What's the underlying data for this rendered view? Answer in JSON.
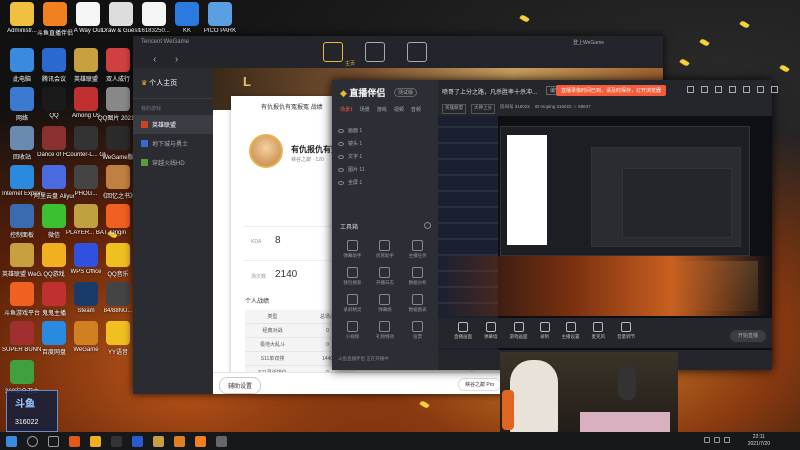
{
  "desktop": {
    "icons": [
      {
        "label": "Administr...",
        "color": "#f0c040"
      },
      {
        "label": "斗鱼直播伴侣",
        "color": "#f08020"
      },
      {
        "label": "A Way Out",
        "color": "#f5f5f5"
      },
      {
        "label": "Draw & Guess",
        "color": "#ddd"
      },
      {
        "label": "16183250...",
        "color": "#f5f5f5"
      },
      {
        "label": "KK",
        "color": "#2a7ae0"
      },
      {
        "label": "PICO PARK",
        "color": "#5aa0e0"
      },
      {
        "label": "此电脑",
        "color": "#3a8ae0"
      },
      {
        "label": "腾讯会议",
        "color": "#2a6ad0"
      },
      {
        "label": "英雄联盟",
        "color": "#c8a040"
      },
      {
        "label": "双人成行",
        "color": "#d04040"
      },
      {
        "label": "网络",
        "color": "#3a7ad0"
      },
      {
        "label": "QQ",
        "color": "#1a1a1a"
      },
      {
        "label": "Among Us",
        "color": "#c03030"
      },
      {
        "label": "QQ图片 20210523...",
        "color": "#888"
      },
      {
        "label": "回收站",
        "color": "#6a8ab0"
      },
      {
        "label": "Dance of F...",
        "color": "#8a3030"
      },
      {
        "label": "Counter-L... Global Off...",
        "color": "#333"
      },
      {
        "label": "WeGame版",
        "color": "#2a2a2a"
      },
      {
        "label": "Internet Explorer",
        "color": "#2a8ae0"
      },
      {
        "label": "阿里云盘 Aliyun",
        "color": "#4a6ae0"
      },
      {
        "label": "PHOG...",
        "color": "#444"
      },
      {
        "label": "《回忆之书》",
        "color": "#c08040"
      },
      {
        "label": "控制面板",
        "color": "#3a6ab0"
      },
      {
        "label": "微信",
        "color": "#3ac030"
      },
      {
        "label": "PLAYER... BATTLEGR...",
        "color": "#c0a040"
      },
      {
        "label": "Origin",
        "color": "#f06020"
      },
      {
        "label": "英雄联盟 WeGame版",
        "color": "#c8a040"
      },
      {
        "label": "QQ游戏",
        "color": "#f0b020"
      },
      {
        "label": "WPS Office",
        "color": "#3050e0"
      },
      {
        "label": "QQ音乐",
        "color": "#f0c020"
      },
      {
        "label": "斗鱼游戏平台",
        "color": "#f06020"
      },
      {
        "label": "鬼鬼主播",
        "color": "#c03030"
      },
      {
        "label": "Steam",
        "color": "#1a3a6a"
      },
      {
        "label": "84/88NU...",
        "color": "#444"
      },
      {
        "label": "SUPER BUNNY MAN",
        "color": "#a03030"
      },
      {
        "label": "百度网盘",
        "color": "#2a8ae0"
      },
      {
        "label": "WeGame",
        "color": "#d08020"
      },
      {
        "label": "YY语音",
        "color": "#f0c020"
      },
      {
        "label": "360安全卫士",
        "color": "#40a040"
      }
    ]
  },
  "wegame": {
    "brand": "Tencent WeGame",
    "nav_home_label": "主页",
    "title_right": "登上WeGame",
    "sidebar_header": "个人主页",
    "sidebar_section": "我的游戏",
    "sidebar_items": [
      "英雄联盟",
      "地下城与勇士",
      "穿越火线HD"
    ],
    "card_tabs": "有仇报仇有冤报冤    战绩",
    "player_name": "有仇报仇有冤",
    "player_server": "峡谷之巅 · 120",
    "stats": [
      {
        "key": "KDA",
        "value": "8"
      },
      {
        "key": "场次数",
        "value": "2140"
      }
    ],
    "personal_title": "个人战绩",
    "table_header": [
      "类型",
      "总场次"
    ],
    "table_rows": [
      [
        "经典对战",
        "0"
      ],
      [
        "极地大乱斗",
        "0"
      ],
      [
        "S11单双排",
        "1440"
      ],
      [
        "S11灵活排位",
        "0"
      ]
    ],
    "assist_label": "辅助设置",
    "chip_label": "峡谷之巅 Pro"
  },
  "stream_app": {
    "logo": "直播伴侣",
    "badge": "测试版",
    "tabs": [
      "场景1",
      "场景",
      "游戏",
      "视频",
      "音频"
    ],
    "scenes": [
      "画面 1",
      "镜头 1",
      "文字 1",
      "图片 11",
      "全屏 1"
    ],
    "tools_title": "工具箱",
    "tools": [
      "弹幕助手",
      "房管助手",
      "主播任务",
      "钱包搜索",
      "开播日志",
      "数据分析",
      "录屏精灵",
      "弹幕姬",
      "数据图表",
      "小视频",
      "礼物特效",
      "投票"
    ],
    "footer": "斗鱼直播伴侣 正在开播中",
    "room_title": "喷哥了上分之路，凡杀胜率十杀冲...",
    "edit_label": "编辑",
    "notice": "直播录像时间已到，请及时保存，打开浏览器",
    "sub_tags": [
      "英雄联盟",
      "大神上分",
      "房间号 316022"
    ],
    "sub_meta": "ID:moping  316022  ☆ 68637",
    "controls": [
      "直播画面",
      "弹幕墙",
      "游戏画面",
      "录制",
      "主播设置",
      "麦克风",
      "音量调节"
    ],
    "golive": "开始直播"
  },
  "overlay": {
    "logo_text": "斗鱼",
    "room_number": "316022"
  },
  "taskbar": {
    "time": "22:11",
    "date": "2021/7/20"
  }
}
